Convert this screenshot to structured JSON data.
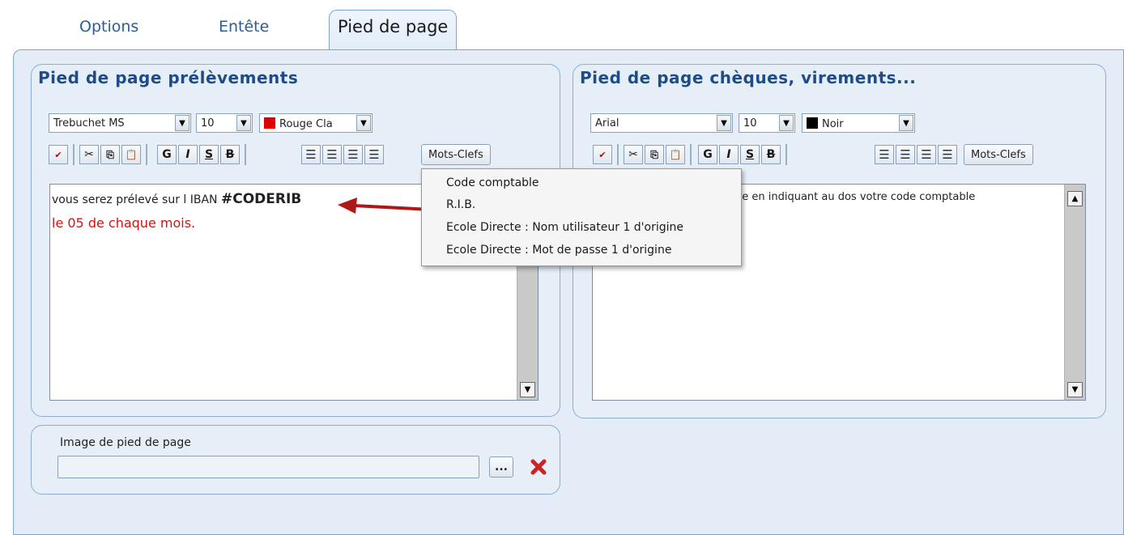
{
  "tabs": [
    {
      "label": "Options"
    },
    {
      "label": "Entête"
    },
    {
      "label": "Pied de page"
    }
  ],
  "left_group": {
    "title": "Pied de page prélèvements",
    "font": "Trebuchet MS",
    "size": "10",
    "color_label": "Rouge Cla",
    "color_hex": "#e00000",
    "keywords_label": "Mots-Clefs",
    "text_line1": "vous serez prélevé sur l IBAN ",
    "text_line1_key": "#CODERIB",
    "text_line2": "le 05 de chaque mois."
  },
  "right_group": {
    "title": "Pied de page chèques, virements...",
    "font": "Arial",
    "size": "10",
    "color_label": "Noir",
    "color_hex": "#000000",
    "keywords_label": "Mots-Clefs",
    "text_line1": "ue en indiquant au dos votre code comptable"
  },
  "keywords_menu": [
    {
      "label": "Code comptable"
    },
    {
      "label": "R.I.B."
    },
    {
      "label": "Ecole Directe : Nom utilisateur 1 d'origine"
    },
    {
      "label": "Ecole Directe : Mot de passe 1 d'origine"
    }
  ],
  "image_group": {
    "label": "Image de pied de page",
    "value": "",
    "browse_label": "..."
  },
  "toolbar": {
    "bold": "G",
    "italic": "I",
    "underline": "S",
    "strike": "B"
  },
  "colors": {
    "accent": "#1f4c86",
    "arrow": "#b01818",
    "delete": "#cc2222"
  }
}
